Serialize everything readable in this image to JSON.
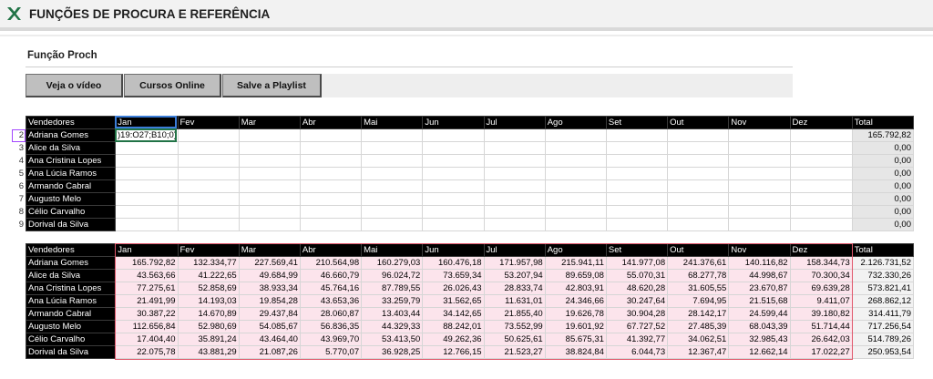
{
  "app": {
    "title": "FUNÇÕES DE PROCURA E REFERÊNCIA",
    "logo_icon": "excel-x-icon",
    "accent": "#217346"
  },
  "section": {
    "title": "Função Proch"
  },
  "buttons": [
    {
      "label": "Veja o vídeo"
    },
    {
      "label": "Cursos Online"
    },
    {
      "label": "Salve a Playlist"
    }
  ],
  "table1": {
    "headers": [
      "Vendedores",
      "Jan",
      "Fev",
      "Mar",
      "Abr",
      "Mai",
      "Jun",
      "Jul",
      "Ago",
      "Set",
      "Out",
      "Nov",
      "Dez",
      "Total"
    ],
    "row_numbers": [
      "2",
      "3",
      "4",
      "5",
      "6",
      "7",
      "8",
      "9"
    ],
    "formula_cell": ")19:O27;B10;0)",
    "rows": [
      {
        "name": "Adriana Gomes",
        "total": "165.792,82"
      },
      {
        "name": "Alice da Silva",
        "total": "0,00"
      },
      {
        "name": "Ana Cristina Lopes",
        "total": "0,00"
      },
      {
        "name": "Ana Lúcia Ramos",
        "total": "0,00"
      },
      {
        "name": "Armando Cabral",
        "total": "0,00"
      },
      {
        "name": "Augusto Melo",
        "total": "0,00"
      },
      {
        "name": "Célio Carvalho",
        "total": "0,00"
      },
      {
        "name": "Dorival da Silva",
        "total": "0,00"
      }
    ]
  },
  "table2": {
    "headers": [
      "Vendedores",
      "Jan",
      "Fev",
      "Mar",
      "Abr",
      "Mai",
      "Jun",
      "Jul",
      "Ago",
      "Set",
      "Out",
      "Nov",
      "Dez",
      "Total"
    ],
    "rows": [
      {
        "name": "Adriana Gomes",
        "values": [
          "165.792,82",
          "132.334,77",
          "227.569,41",
          "210.564,98",
          "160.279,03",
          "160.476,18",
          "171.957,98",
          "215.941,11",
          "141.977,08",
          "241.376,61",
          "140.116,82",
          "158.344,73"
        ],
        "total": "2.126.731,52"
      },
      {
        "name": "Alice da Silva",
        "values": [
          "43.563,66",
          "41.222,65",
          "49.684,99",
          "46.660,79",
          "96.024,72",
          "73.659,34",
          "53.207,94",
          "89.659,08",
          "55.070,31",
          "68.277,78",
          "44.998,67",
          "70.300,34"
        ],
        "total": "732.330,26"
      },
      {
        "name": "Ana Cristina Lopes",
        "values": [
          "77.275,61",
          "52.858,69",
          "38.933,34",
          "45.764,16",
          "87.789,55",
          "26.026,43",
          "28.833,74",
          "42.803,91",
          "48.620,28",
          "31.605,55",
          "23.670,87",
          "69.639,28"
        ],
        "total": "573.821,41"
      },
      {
        "name": "Ana Lúcia Ramos",
        "values": [
          "21.491,99",
          "14.193,03",
          "19.854,28",
          "43.653,36",
          "33.259,79",
          "31.562,65",
          "11.631,01",
          "24.346,66",
          "30.247,64",
          "7.694,95",
          "21.515,68",
          "9.411,07"
        ],
        "total": "268.862,12"
      },
      {
        "name": "Armando Cabral",
        "values": [
          "30.387,22",
          "14.670,89",
          "29.437,84",
          "28.060,87",
          "13.403,44",
          "34.142,65",
          "21.855,40",
          "19.626,78",
          "30.904,28",
          "28.142,17",
          "24.599,44",
          "39.180,82"
        ],
        "total": "314.411,79"
      },
      {
        "name": "Augusto Melo",
        "values": [
          "112.656,84",
          "52.980,69",
          "54.085,67",
          "56.836,35",
          "44.329,33",
          "88.242,01",
          "73.552,99",
          "19.601,92",
          "67.727,52",
          "27.485,39",
          "68.043,39",
          "51.714,44"
        ],
        "total": "717.256,54"
      },
      {
        "name": "Célio Carvalho",
        "values": [
          "17.404,40",
          "35.891,24",
          "43.464,40",
          "43.969,70",
          "53.413,50",
          "49.262,36",
          "50.625,61",
          "85.675,31",
          "41.392,77",
          "34.062,51",
          "32.985,43",
          "26.642,03"
        ],
        "total": "514.789,26"
      },
      {
        "name": "Dorival da Silva",
        "values": [
          "22.075,78",
          "43.881,29",
          "21.087,26",
          "5.770,07",
          "36.928,25",
          "12.766,15",
          "21.523,27",
          "38.824,84",
          "6.044,73",
          "12.367,47",
          "12.662,14",
          "17.022,27"
        ],
        "total": "250.953,54"
      }
    ]
  }
}
